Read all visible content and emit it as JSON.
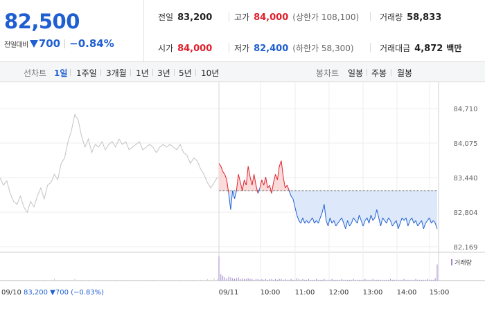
{
  "summary": {
    "price": "82,500",
    "change_label": "전일대비",
    "change_value": "700",
    "change_rate": "−0.84%",
    "prev_label": "전일",
    "prev_value": "83,200",
    "high_label": "고가",
    "high_value": "84,000",
    "high_sub": "(상한가 108,100)",
    "volume_label": "거래량",
    "volume_value": "58,833",
    "open_label": "시가",
    "open_value": "84,000",
    "low_label": "저가",
    "low_value": "82,400",
    "low_sub": "(하한가 58,300)",
    "amount_label": "거래대금",
    "amount_value": "4,872",
    "amount_unit": "백만"
  },
  "period_bar": {
    "line_label": "선차트",
    "line_items": [
      "1일",
      "1주일",
      "3개월",
      "1년",
      "3년",
      "5년",
      "10년"
    ],
    "active_line_item": "1일",
    "candle_label": "봉차트",
    "candle_items": [
      "일봉",
      "주봉",
      "월봉"
    ]
  },
  "chart": {
    "y_ticks": [
      "84,710",
      "84,075",
      "83,440",
      "82,804",
      "82,169"
    ],
    "x_ticks": [
      "09/11",
      "10:00",
      "11:00",
      "12:00",
      "13:00",
      "14:00",
      "15:00"
    ],
    "prev_day_label": "09/10",
    "prev_close_text": "83,200 ▼700 (−0.83%)",
    "volume_legend": "거래량",
    "colors": {
      "up": "#e0202c",
      "down": "#1f5fd1",
      "prev": "#c3c3c3",
      "fill_down": "#dde9fb",
      "fill_up": "#fbdada",
      "base": "#666666"
    }
  },
  "chart_data": {
    "type": "line",
    "y_range": [
      82169,
      84710
    ],
    "base_value": 83200,
    "series": [
      {
        "name": "",
        "segment": "previous-day",
        "values": [
          83440,
          83300,
          83380,
          83150,
          83000,
          82950,
          83100,
          82900,
          82800,
          83000,
          82900,
          83100,
          83250,
          83050,
          83300,
          83350,
          83500,
          83400,
          83700,
          83800,
          84100,
          84300,
          84600,
          84500,
          84200,
          84000,
          84150,
          83900,
          84050,
          84000,
          84100,
          83950,
          84050,
          84100,
          84000,
          84150,
          84050,
          84100,
          83950,
          84000,
          84050,
          84100,
          83950,
          84000,
          84050,
          84000,
          83900,
          84000,
          84050,
          84000,
          84050,
          84000,
          83950,
          84050,
          83900,
          83850,
          83700,
          83800,
          83750,
          83600,
          83500,
          83350,
          83250,
          83350,
          83450
        ]
      },
      {
        "name": "",
        "segment": "today",
        "values": [
          83700,
          83650,
          83550,
          83500,
          83400,
          83150,
          82850,
          83200,
          83050,
          83200,
          83500,
          83350,
          83200,
          83400,
          83300,
          83650,
          83450,
          83300,
          83500,
          83300,
          83150,
          83250,
          83400,
          83300,
          83450,
          83250,
          83300,
          83150,
          83350,
          83500,
          83400,
          83650,
          83750,
          83450,
          83250,
          83300,
          83200,
          83100,
          83050,
          82900,
          82750,
          82650,
          82600,
          82700,
          82600,
          82650,
          82600,
          82650,
          82700,
          82600,
          82650,
          82600,
          82700,
          82800,
          82950,
          82650,
          82550,
          82700,
          82600,
          82650,
          82550,
          82600,
          82650,
          82700,
          82600,
          82500,
          82650,
          82550,
          82600,
          82700,
          82650,
          82600,
          82750,
          82650,
          82550,
          82650,
          82700,
          82600,
          82750,
          82650,
          82700,
          82850,
          82700,
          82550,
          82700,
          82650,
          82600,
          82700,
          82650,
          82550,
          82600,
          82650,
          82500,
          82600,
          82700,
          82650,
          82700,
          82550,
          82650,
          82700,
          82600,
          82650,
          82550,
          82600,
          82650,
          82500,
          82600,
          82650,
          82700,
          82600,
          82650,
          82600,
          82500
        ]
      }
    ],
    "volume": {
      "previous-day": [
        0,
        0,
        0,
        1,
        0,
        0,
        0,
        1,
        0,
        0,
        0,
        1,
        0,
        1,
        0,
        0,
        2,
        1,
        0,
        1,
        1,
        0,
        2,
        1,
        1,
        0,
        1,
        0,
        0,
        1,
        0,
        0,
        1,
        0,
        1,
        0,
        0,
        1,
        0,
        0,
        1,
        0,
        0,
        1,
        0,
        1,
        0,
        0,
        1,
        0,
        1,
        0,
        0,
        1,
        0,
        1,
        0,
        1,
        0,
        1,
        0,
        2,
        1,
        3,
        2
      ],
      "today": [
        30,
        8,
        6,
        4,
        3,
        5,
        4,
        3,
        2,
        3,
        4,
        2,
        3,
        2,
        2,
        3,
        2,
        2,
        1,
        2,
        2,
        1,
        2,
        1,
        2,
        1,
        2,
        2,
        1,
        2,
        1,
        2,
        2,
        1,
        2,
        1,
        1,
        2,
        1,
        1,
        3,
        2,
        1,
        2,
        1,
        1,
        2,
        1,
        1,
        1,
        2,
        1,
        1,
        1,
        2,
        1,
        1,
        1,
        2,
        1,
        1,
        1,
        1,
        2,
        1,
        1,
        1,
        1,
        1,
        2,
        1,
        1,
        1,
        1,
        1,
        2,
        1,
        1,
        1,
        2,
        1,
        1,
        1,
        1,
        1,
        1,
        1,
        1,
        2,
        1,
        1,
        1,
        1,
        1,
        1,
        2,
        1,
        1,
        1,
        1,
        1,
        2,
        1,
        1,
        1,
        1,
        1,
        2,
        1,
        1,
        1,
        3,
        20
      ]
    }
  }
}
